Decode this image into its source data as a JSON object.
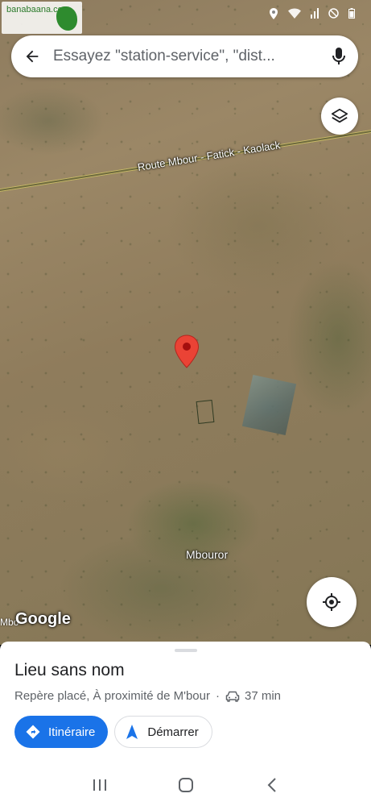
{
  "watermark": {
    "text": "banabaana.com"
  },
  "search": {
    "placeholder": "Essayez \"station-service\", \"dist..."
  },
  "map": {
    "road_label": "Route Mbour - Fatick - Kaolack",
    "place_label": "Mbouror",
    "edge_label": "Mbo",
    "google_logo": "Google"
  },
  "place": {
    "title": "Lieu sans nom",
    "subtitle": "Repère placé, À proximité de M'bour",
    "separator": "·",
    "drive_time": "37 min"
  },
  "actions": {
    "directions_label": "Itinéraire",
    "start_label": "Démarrer"
  },
  "colors": {
    "accent": "#1a73e8",
    "pin": "#ea4335"
  },
  "icons": [
    "back-arrow-icon",
    "mic-icon",
    "layers-icon",
    "my-location-icon",
    "car-icon",
    "directions-icon",
    "navigation-icon",
    "recent-apps-icon",
    "home-icon",
    "back-icon"
  ]
}
